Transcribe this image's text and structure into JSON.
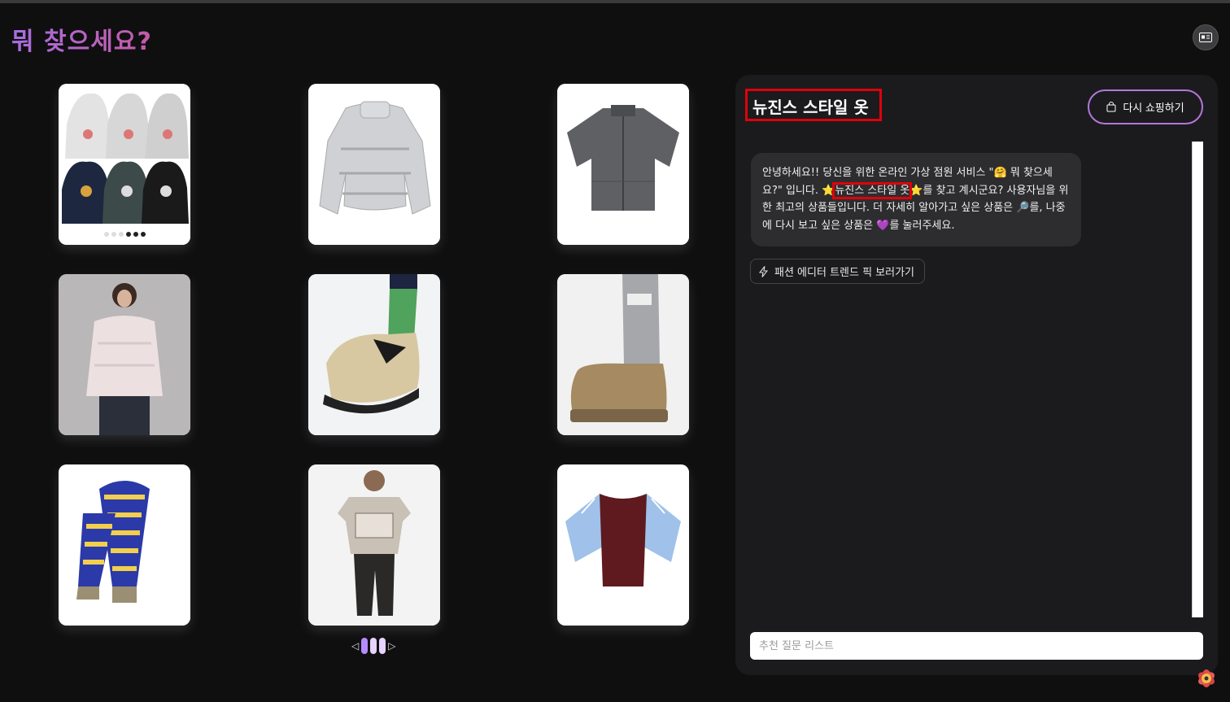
{
  "header": {
    "title": "뭐 찾으세요?"
  },
  "products": [
    {
      "name": "hoodie-set",
      "colors": [
        "#e5e5e5",
        "#b7b7b7",
        "#1d2740",
        "#3a3a3a"
      ],
      "dots": 6
    },
    {
      "name": "silver-puffer"
    },
    {
      "name": "gray-short-sleeve-jacket"
    },
    {
      "name": "pink-puffer-model"
    },
    {
      "name": "beige-slip-on-shoe"
    },
    {
      "name": "ugg-boot-leg-warmer"
    },
    {
      "name": "striped-scarf"
    },
    {
      "name": "graphic-tee-model"
    },
    {
      "name": "burgundy-raglan-tee"
    }
  ],
  "pager": {
    "prev": "◁",
    "next": "▷"
  },
  "chat": {
    "title": "뉴진스 스타일 옷",
    "reshop_label": "다시 쇼핑하기",
    "msg_part1": "안녕하세요!! 당신을 위한 온라인 가상 점원 서비스 \"🤗 뭐 찾으세요?\" 입니다. ⭐",
    "msg_highlight": "뉴진스 스타일 옷",
    "msg_part2": "⭐를 찾고 계시군요? 사용자님을 위한 최고의 상품들입니다. 더 자세히 알아가고 싶은 상품은 🔎를, 나중에 다시 보고 싶은 상품은 💜를 눌러주세요.",
    "trend_label": "패션 에디터 트렌드 픽 보러가기",
    "input_placeholder": "추천 질문 리스트"
  },
  "colors": {
    "accent": "#b277d9",
    "highlight": "#e0000a",
    "panel": "#1b1b1d"
  }
}
